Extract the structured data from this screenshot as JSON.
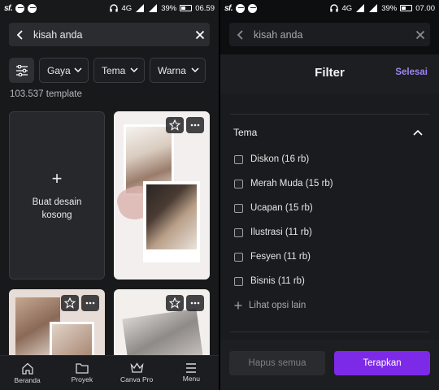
{
  "left_status": {
    "carrier": "SF",
    "net": "4G",
    "battery": "39%",
    "time": "06.59"
  },
  "right_status": {
    "carrier": "SF",
    "net": "4G",
    "battery": "39%",
    "time": "07.00"
  },
  "search": {
    "query": "kisah anda"
  },
  "filters": {
    "style": "Gaya",
    "theme": "Tema",
    "color": "Warna"
  },
  "result_count": "103.537 template",
  "blank_card": {
    "label": "Buat desain kosong"
  },
  "bottom_nav": {
    "items": [
      {
        "label": "Beranda",
        "icon": "home-icon"
      },
      {
        "label": "Proyek",
        "icon": "folder-icon"
      },
      {
        "label": "Canva Pro",
        "icon": "crown-icon"
      },
      {
        "label": "Menu",
        "icon": "menu-icon"
      }
    ]
  },
  "filter_panel": {
    "title": "Filter",
    "done": "Selesai",
    "section": "Tema",
    "options": [
      {
        "label": "Diskon (16 rb)",
        "checked": false
      },
      {
        "label": "Merah Muda (15 rb)",
        "checked": false
      },
      {
        "label": "Ucapan (15 rb)",
        "checked": false
      },
      {
        "label": "Ilustrasi (11 rb)",
        "checked": false
      },
      {
        "label": "Fesyen (11 rb)",
        "checked": false
      },
      {
        "label": "Bisnis (11 rb)",
        "checked": false
      }
    ],
    "more": "Lihat opsi lain",
    "clear": "Hapus semua",
    "apply": "Terapkan"
  },
  "colors": {
    "accent": "#7d2ae8",
    "link": "#9d86f2"
  }
}
